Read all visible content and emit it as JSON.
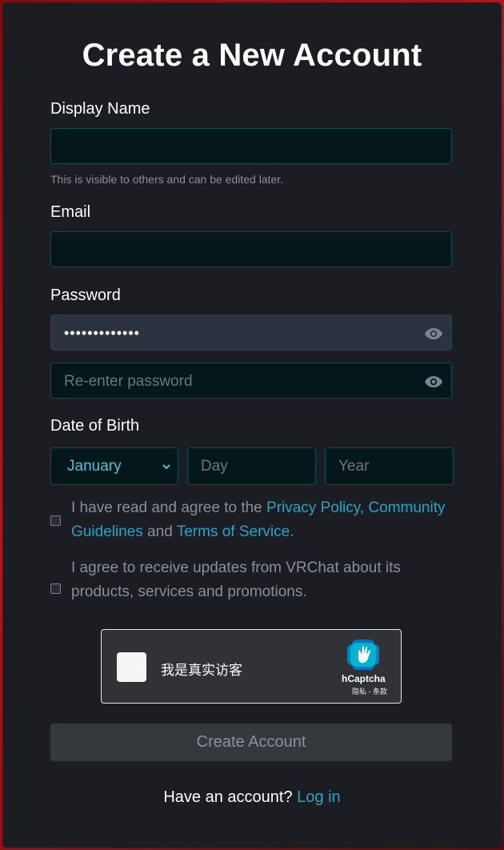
{
  "page": {
    "title": "Create a New Account"
  },
  "display_name": {
    "label": "Display Name",
    "value": "",
    "hint": "This is visible to others and can be edited later."
  },
  "email": {
    "label": "Email",
    "value": ""
  },
  "password": {
    "label": "Password",
    "value": "•••••••••••••",
    "reenter_placeholder": "Re-enter password"
  },
  "dob": {
    "label": "Date of Birth",
    "month": "January",
    "day_placeholder": "Day",
    "year_placeholder": "Year"
  },
  "terms": {
    "prefix": "I have read and agree to the ",
    "privacy": "Privacy Policy",
    "comma": ",",
    "guidelines": "Community Guidelines",
    "and": " and ",
    "tos": "Terms of Service",
    "period": "."
  },
  "updates": {
    "text": "I agree to receive updates from VRChat about its products, services and promotions."
  },
  "captcha": {
    "label": "我是真实访客",
    "brand": "hCaptcha",
    "terms": "隐私 - 条款"
  },
  "submit": {
    "label": "Create Account"
  },
  "login": {
    "prompt": "Have an account? ",
    "link": "Log in"
  },
  "colors": {
    "accent": "#27a3c2",
    "field_bg": "#04171b",
    "panel_bg": "#1b1d22"
  }
}
